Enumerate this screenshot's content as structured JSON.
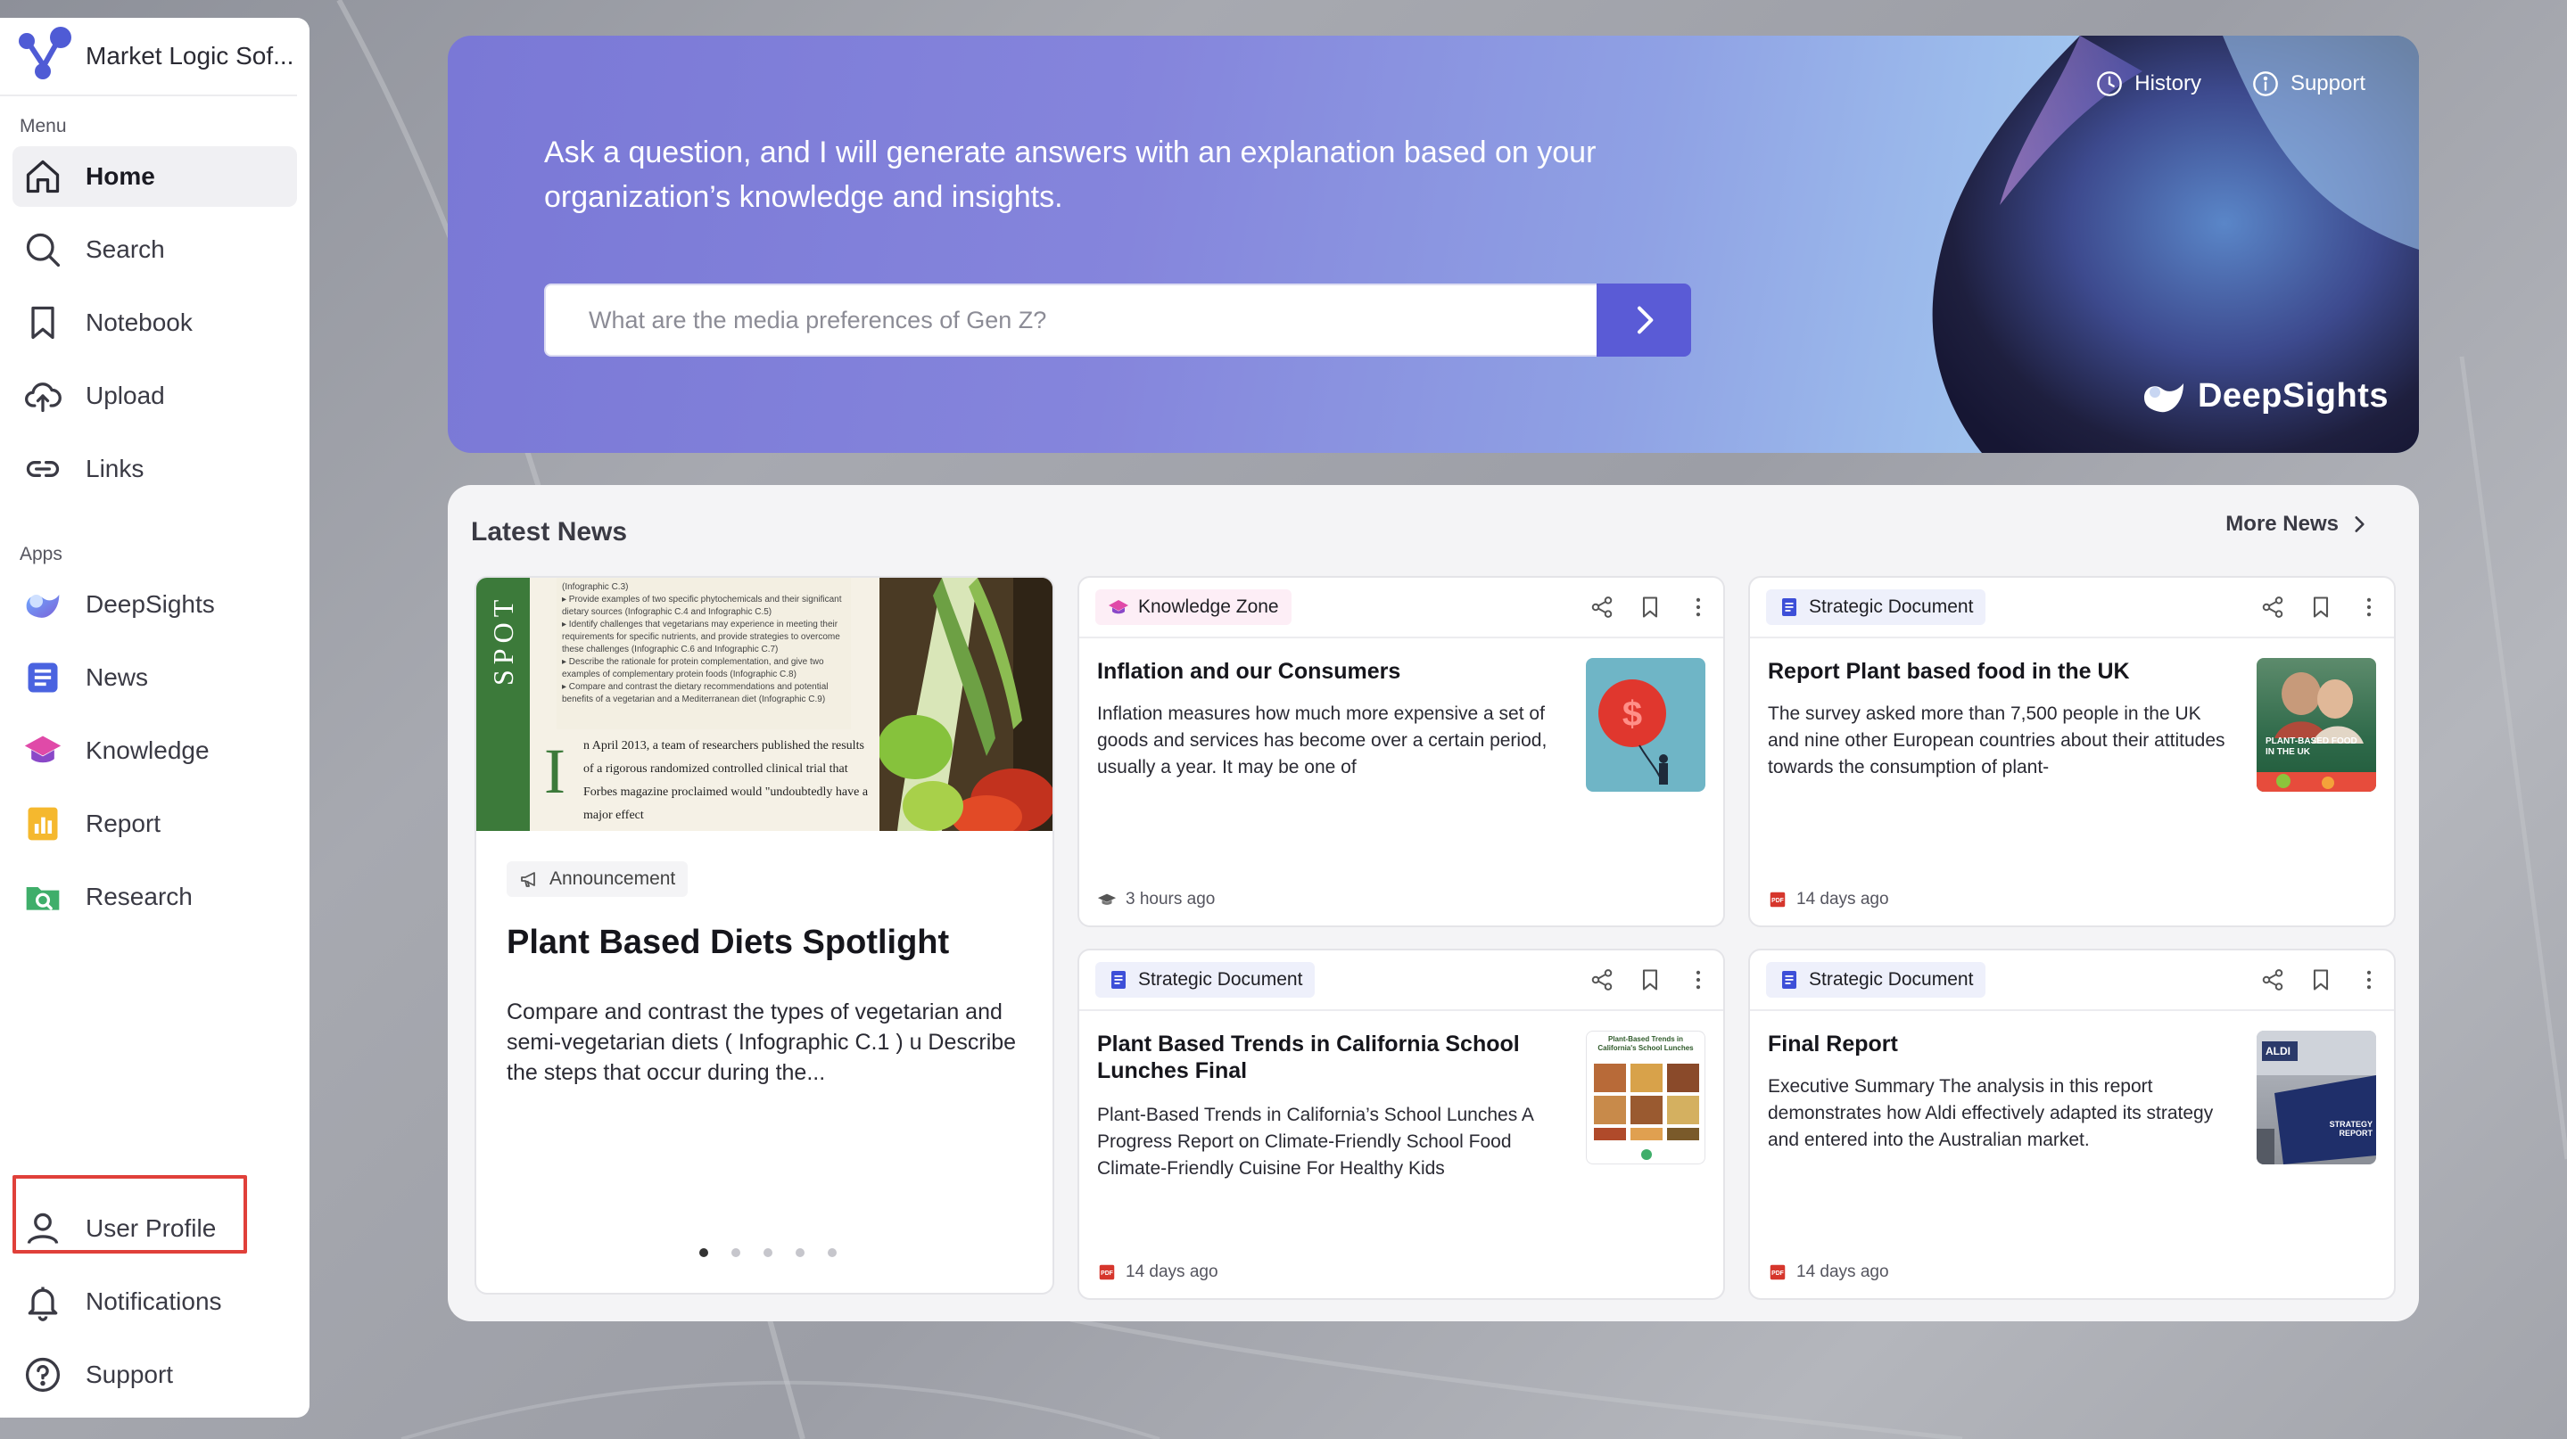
{
  "sidebar": {
    "org_name": "Market Logic Sof...",
    "menu_label": "Menu",
    "apps_label": "Apps",
    "menu_items": [
      {
        "label": "Home",
        "icon": "home-icon"
      },
      {
        "label": "Search",
        "icon": "search-icon"
      },
      {
        "label": "Notebook",
        "icon": "bookmark-icon"
      },
      {
        "label": "Upload",
        "icon": "upload-cloud-icon"
      },
      {
        "label": "Links",
        "icon": "link-icon"
      }
    ],
    "app_items": [
      {
        "label": "DeepSights",
        "icon": "deepsights-icon"
      },
      {
        "label": "News",
        "icon": "news-icon"
      },
      {
        "label": "Knowledge",
        "icon": "knowledge-icon"
      },
      {
        "label": "Report",
        "icon": "report-icon"
      },
      {
        "label": "Research",
        "icon": "research-icon"
      }
    ],
    "bottom_items": [
      {
        "label": "User Profile",
        "icon": "user-icon"
      },
      {
        "label": "Notifications",
        "icon": "bell-icon"
      },
      {
        "label": "Support",
        "icon": "help-circle-icon"
      }
    ]
  },
  "hero": {
    "history_label": "History",
    "support_label": "Support",
    "prompt": "Ask a question, and I will generate answers with an explanation based on your organization’s knowledge and insights.",
    "search_placeholder": "What are the media preferences of Gen Z?",
    "brand": "DeepSights"
  },
  "news": {
    "title": "Latest News",
    "more_label": "More News",
    "feature": {
      "badge": "Announcement",
      "title": "Plant Based Diets Spotlight",
      "description": "Compare and contrast the types of vegetarian and semi-vegetarian diets ( Infographic C.1 ) u Describe the steps that occur during the...",
      "image_side_text": "SPOT",
      "image_body": "n April 2013, a team of researchers published the results of a rigorous randomized controlled clinical trial that Forbes magazine proclaimed would \"undoubtedly have a major effect",
      "image_dropcap": "I",
      "image_bullets": "(Infographic C.3)\n▸ Provide examples of two specific phytochemicals and their significant dietary sources (Infographic C.4 and Infographic C.5)\n▸ Identify challenges that vegetarians may experience in meeting their requirements for specific nutrients, and provide strategies to overcome these challenges (Infographic C.6 and Infographic C.7)\n▸ Describe the rationale for protein complementation, and give two examples of complementary protein foods (Infographic C.8)\n▸ Compare and contrast the dietary recommendations and potential benefits of a vegetarian and a Mediterranean diet (Infographic C.9)"
    },
    "cards": [
      {
        "badge": "Knowledge Zone",
        "title": "Inflation and our Consumers",
        "description": "Inflation measures how much more expensive a set of goods and services has become over a certain period, usually a year. It may be one of",
        "footer": "3 hours ago"
      },
      {
        "badge": "Strategic Document",
        "title": "Report Plant based food in the UK",
        "description": "The survey asked more than 7,500 people in the UK and nine other European countries about their attitudes towards the consumption of plant-",
        "footer": "14 days ago",
        "thumb_text": "PLANT-BASED FOOD IN THE UK"
      },
      {
        "badge": "Strategic Document",
        "title": "Plant Based Trends in California School Lunches Final",
        "description": "Plant-Based Trends in California’s School Lunches A Progress Report on Climate-Friendly School Food Climate-Friendly Cuisine For Healthy Kids",
        "footer": "14 days ago",
        "thumb_text": "Plant-Based Trends in California's School Lunches"
      },
      {
        "badge": "Strategic Document",
        "title": "Final Report",
        "description": "Executive Summary The analysis in this report demonstrates how Aldi effectively adapted its strategy and entered into the Australian market.",
        "footer": "14 days ago",
        "thumb_text": "ALDI",
        "thumb_sub": "STRATEGY REPORT"
      }
    ]
  },
  "colors": {
    "accent": "#5a5bd6",
    "highlight": "#e0403a"
  }
}
